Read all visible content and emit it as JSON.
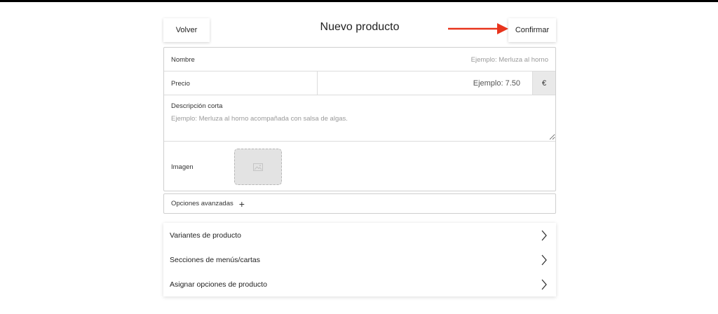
{
  "header": {
    "back_label": "Volver",
    "title": "Nuevo producto",
    "confirm_label": "Confirmar",
    "arrow_color": "#e8341c"
  },
  "form": {
    "name": {
      "label": "Nombre",
      "placeholder": "Ejemplo: Merluza al horno"
    },
    "price": {
      "label": "Precio",
      "placeholder": "Ejemplo: 7.50",
      "currency": "€"
    },
    "description": {
      "label": "Descripción corta",
      "placeholder": "Ejemplo: Merluza al horno acompañada con salsa de algas."
    },
    "image": {
      "label": "Imagen",
      "icon": "image-placeholder-icon"
    }
  },
  "advanced": {
    "label": "Opciones avanzadas",
    "icon": "plus-icon"
  },
  "list": {
    "items": [
      {
        "label": "Variantes de producto"
      },
      {
        "label": "Secciones de menús/cartas"
      },
      {
        "label": "Asignar opciones de producto"
      }
    ]
  }
}
